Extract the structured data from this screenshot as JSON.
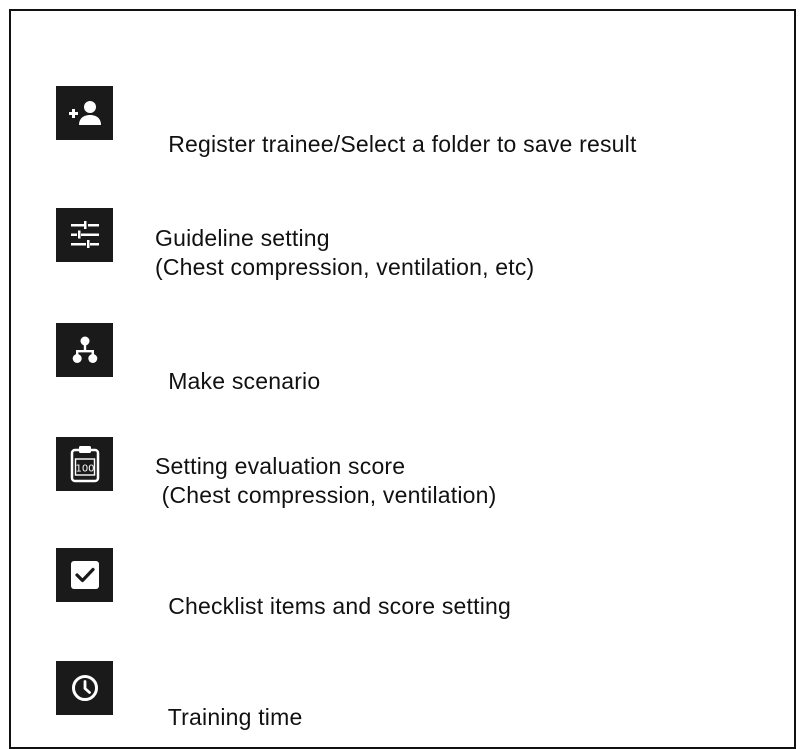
{
  "colors": {
    "icon_background": "#1a1a1a",
    "icon_foreground": "#ffffff",
    "text": "#111111",
    "border": "#111111"
  },
  "items": [
    {
      "icon": "person-add-icon",
      "line1": "Register trainee/Select a folder to save result",
      "line2": ""
    },
    {
      "icon": "sliders-icon",
      "line1": "Guideline setting",
      "line2": "(Chest compression, ventilation, etc)"
    },
    {
      "icon": "scenario-tree-icon",
      "line1": "Make scenario",
      "line2": ""
    },
    {
      "icon": "clipboard-score-icon",
      "line1": "Setting evaluation score",
      "line2": " (Chest compression, ventilation)",
      "icon_text": "100"
    },
    {
      "icon": "checkbox-icon",
      "line1": "Checklist items and score setting",
      "line2": ""
    },
    {
      "icon": "clock-icon",
      "line1": "Training time",
      "line2": ""
    }
  ]
}
